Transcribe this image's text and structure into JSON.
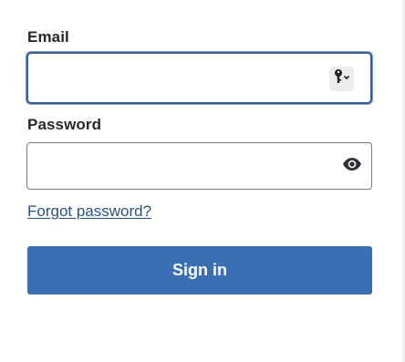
{
  "form": {
    "email_label": "Email",
    "email_value": "",
    "password_label": "Password",
    "password_value": "",
    "forgot_link": "Forgot password?",
    "signin_label": "Sign in"
  },
  "icons": {
    "email_suffix": "password-key-autofill-icon",
    "password_suffix": "show-password-eye-icon"
  },
  "colors": {
    "primary": "#3b6fb3",
    "focus_border": "#3a5f8f",
    "link": "#2b527e",
    "label_text": "#26292d"
  }
}
